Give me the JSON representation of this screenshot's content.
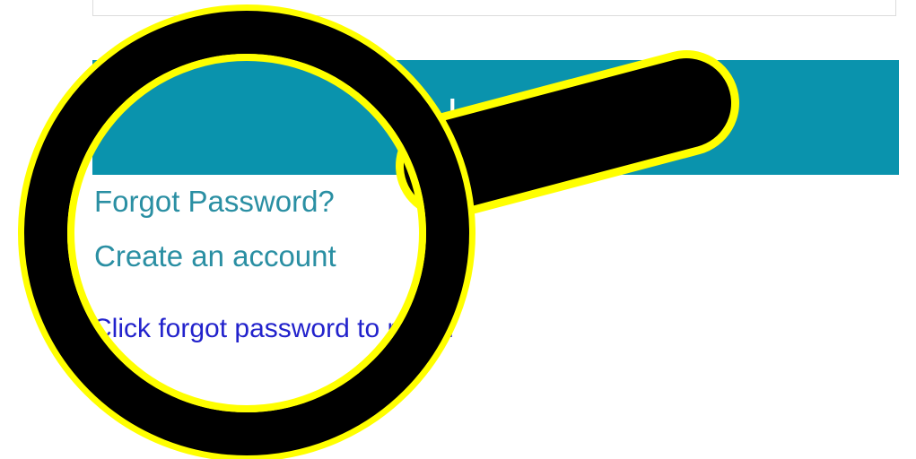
{
  "login": {
    "button_label": "Login"
  },
  "links": {
    "forgot_password": "Forgot Password?",
    "create_account": "Create an account"
  },
  "hint": {
    "text": "Click forgot password to reset."
  },
  "colors": {
    "button_bg": "#0a93ad",
    "link": "#2a8fa3",
    "hint": "#2222cc",
    "magnifier_rim": "#ffff00",
    "magnifier_body": "#000000"
  },
  "icons": {
    "overlay": "magnifying-glass-icon"
  }
}
